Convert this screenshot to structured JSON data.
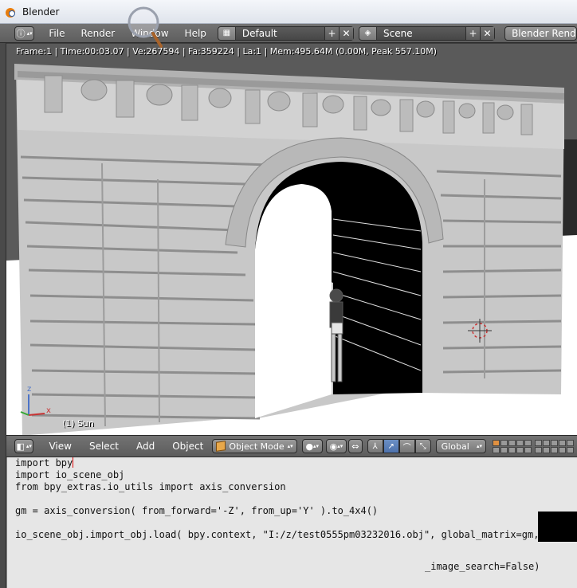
{
  "window": {
    "title": "Blender"
  },
  "info_header": {
    "menus": [
      "File",
      "Render",
      "Window",
      "Help"
    ],
    "screen_layout": "Default",
    "scene": "Scene",
    "render_engine": "Blender Render"
  },
  "viewport": {
    "stats": "Frame:1 | Time:00:03.07 | Ve:267594 | Fa:359224 | La:1 | Mem:495.64M (0.00M, Peak 557.10M)",
    "active_object": "(1) Sun",
    "axis_labels": {
      "x": "x",
      "z": "z"
    }
  },
  "view_header": {
    "menus": [
      "View",
      "Select",
      "Add",
      "Object"
    ],
    "mode": "Object Mode",
    "orientation": "Global"
  },
  "text_editor": {
    "lines": [
      "import bpy",
      "import io_scene_obj",
      "from bpy_extras.io_utils import axis_conversion",
      "",
      "gm = axis_conversion( from_forward='-Z', from_up='Y' ).to_4x4()",
      "",
      "io_scene_obj.import_obj.load( bpy.context, \"I:/z/test0555pm03232016.obj\", global_matrix=gm,use",
      "",
      "",
      "_image_search=False)"
    ]
  },
  "colors": {
    "accent_blue": "#5680c2",
    "cursor_red": "#e01010",
    "header_gray": "#6a6a6a"
  }
}
